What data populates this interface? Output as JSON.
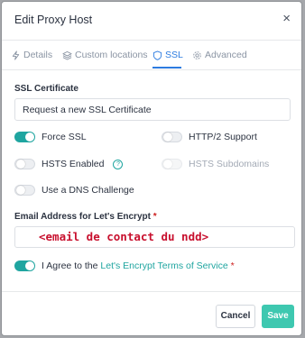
{
  "modal": {
    "title": "Edit Proxy Host",
    "close_icon": "×"
  },
  "tabs": [
    {
      "label": "Details",
      "icon": "bolt-icon"
    },
    {
      "label": "Custom locations",
      "icon": "layers-icon"
    },
    {
      "label": "SSL",
      "icon": "shield-icon",
      "active": true
    },
    {
      "label": "Advanced",
      "icon": "gear-icon"
    }
  ],
  "ssl": {
    "certificate_label": "SSL Certificate",
    "certificate_value": "Request a new SSL Certificate",
    "force_ssl": {
      "label": "Force SSL",
      "on": true
    },
    "http2": {
      "label": "HTTP/2 Support",
      "on": false
    },
    "hsts": {
      "label": "HSTS Enabled",
      "on": false,
      "help": "?"
    },
    "hsts_subdomains": {
      "label": "HSTS Subdomains",
      "on": false,
      "disabled": true
    },
    "dns_challenge": {
      "label": "Use a DNS Challenge",
      "on": false
    },
    "email_label": "Email Address for Let's Encrypt",
    "required_mark": "*",
    "email_value": "<email de contact du ndd>",
    "agree_prefix": "I Agree to the",
    "agree_link": "Let's Encrypt Terms of Service",
    "agree_on": true
  },
  "footer": {
    "cancel_label": "Cancel",
    "save_label": "Save"
  },
  "colors": {
    "accent": "#1fa5a0",
    "tab_active": "#2c7be0",
    "save_button": "#3ec8b0",
    "required": "#cd201f",
    "overlay": "#a5a7ab"
  }
}
